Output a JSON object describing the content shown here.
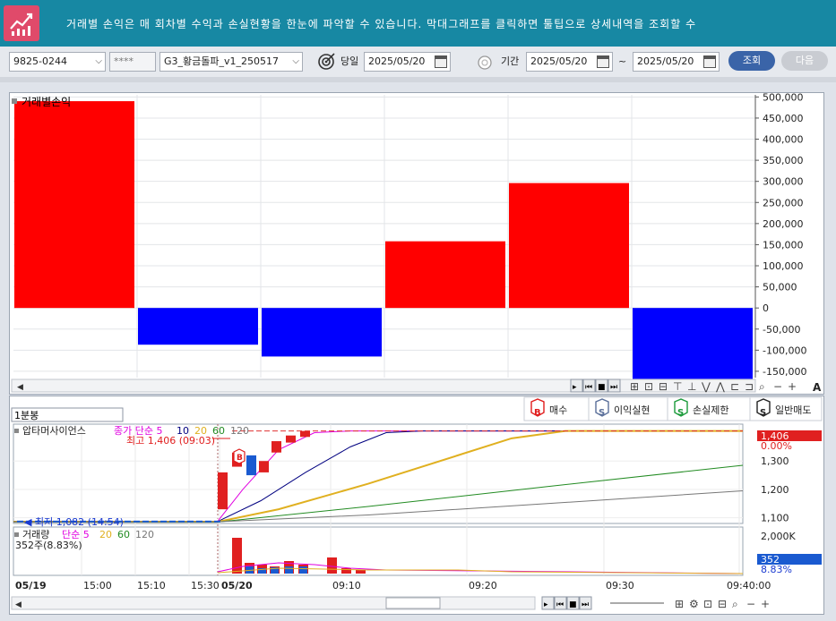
{
  "banner": {
    "text": "거래별 손익은 매 회차별 수익과 손실현황을 한눈에 파악할 수 있습니다. 막대그래프를 클릭하면 툴팁으로 상세내역을 조회할 수",
    "icon": "chart-up-icon"
  },
  "toolbar": {
    "account": "9825-0244",
    "password": "****",
    "strategy": "G3_황금돌파_v1_250517",
    "today_label": "당일",
    "today_date": "2025/05/20",
    "period_label": "기간",
    "period_from": "2025/05/20",
    "period_sep": "~",
    "period_to": "2025/05/20",
    "search_label": "조회",
    "next_label": "다음"
  },
  "top_chart": {
    "title": "거래별손익",
    "y_ticks": [
      "500,000",
      "450,000",
      "400,000",
      "350,000",
      "300,000",
      "250,000",
      "200,000",
      "150,000",
      "100,000",
      "50,000",
      "0",
      "-50,000",
      "-100,000",
      "-150,000"
    ]
  },
  "chart_data": [
    {
      "type": "bar",
      "title": "거래별손익",
      "values": [
        490000,
        -87000,
        -115000,
        158000,
        296000,
        -168000
      ],
      "ylim": [
        -165000,
        505000
      ],
      "colors": {
        "positive": "#ff0000",
        "negative": "#0000ff"
      }
    },
    {
      "type": "line",
      "title": "압타머사이언스",
      "x_ticks": [
        "05/19",
        "15:00",
        "15:10",
        "15:30",
        "05/20",
        "09:10",
        "09:20",
        "09:30",
        "09:40:00"
      ],
      "y_ticks": [
        "1,100",
        "1,200",
        "1,300",
        "1,406"
      ],
      "ylim": [
        1080,
        1430
      ]
    }
  ],
  "bottom": {
    "interval": "1분봉",
    "legend": [
      {
        "label": "매수",
        "icon": "buy-badge-icon",
        "glyph": "B",
        "color": "#e01c1c"
      },
      {
        "label": "이익실현",
        "icon": "profit-take-badge-icon",
        "glyph": "S",
        "color": "#5a6f9a"
      },
      {
        "label": "손실제한",
        "icon": "stop-loss-badge-icon",
        "glyph": "S",
        "color": "#1a9a3a"
      },
      {
        "label": "일반매도",
        "icon": "normal-sell-badge-icon",
        "glyph": "S",
        "color": "#222222"
      }
    ],
    "price": {
      "name": "압타머사이언스",
      "ma_label": "종가 단순 5",
      "ma_periods": [
        "10",
        "20",
        "60",
        "120"
      ],
      "high_label": "최고 1,406 (09:03)",
      "low_label": "최저 1,082 (14:54)",
      "current_price": "1,406",
      "current_pct": "0.00%",
      "top_tick": "1,406"
    },
    "volume": {
      "name": "거래량",
      "ma_label": "단순 5",
      "ma_periods": [
        "20",
        "60",
        "120"
      ],
      "summary": "352주(8.83%)",
      "top_tick": "2,000K",
      "current": "352",
      "current_pct": "8.83%"
    },
    "time_axis": [
      "05/19",
      "15:00",
      "15:10",
      "15:30",
      "05/20",
      "09:10",
      "09:20",
      "09:30",
      "09:40:00"
    ],
    "nav_text": "09:"
  },
  "colors": {
    "banner": "#1788a3",
    "up": "#ff0000",
    "down": "#0000ff",
    "ma5": "#e000e0",
    "ma10": "#000080",
    "ma20": "#e0b020",
    "ma60": "#228b22",
    "ma120": "#777777"
  }
}
